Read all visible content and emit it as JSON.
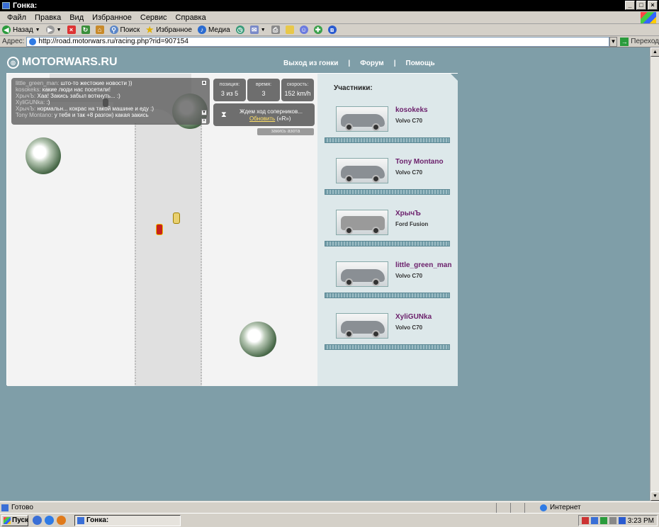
{
  "window": {
    "title": "Гонка:"
  },
  "menu": [
    "Файл",
    "Правка",
    "Вид",
    "Избранное",
    "Сервис",
    "Справка"
  ],
  "toolbar": {
    "back": "Назад",
    "search": "Поиск",
    "favorites": "Избранное",
    "media": "Медиа"
  },
  "address": {
    "label": "Адрес:",
    "url": "http://road.motorwars.ru/racing.php?rid=907154",
    "go": "Переход"
  },
  "site": {
    "logo": "MOTORWARS.RU",
    "nav": [
      "Выход из гонки",
      "Форум",
      "Помощь"
    ],
    "chat": [
      {
        "nick": "little_green_man:",
        "text": " што-то жестокие новости ))"
      },
      {
        "nick": "kosokeks:",
        "text": " какие люди нас посетили!"
      },
      {
        "nick": "ХрычЪ:",
        "text": " Хаа! Закись забыл воткнуть... :)"
      },
      {
        "nick": "XyliGUNka:",
        "text": " :)"
      },
      {
        "nick": "ХрычЪ:",
        "text": " нормальн... кокрас на такой машине и еду :)"
      },
      {
        "nick": "Tony Montano:",
        "text": " у тебя и так +8 разгон) какая закись"
      }
    ],
    "stats": {
      "position_label": "позиция:",
      "position_value": "3 из 5",
      "time_label": "время:",
      "time_value": "3",
      "speed_label": "скорость:",
      "speed_value": "152 km/h"
    },
    "wait": {
      "text": "Ждем ход соперников...",
      "refresh": "Обновить",
      "hotkey": "(«R»)"
    },
    "close_nitro": "закись азота",
    "participants_title": "Участники:",
    "players": [
      {
        "name": "kosokeks",
        "car": "Volvo C70"
      },
      {
        "name": "Tony Montano",
        "car": "Volvo C70"
      },
      {
        "name": "ХрычЪ",
        "car": "Ford Fusion"
      },
      {
        "name": "little_green_man",
        "car": "Volvo C70"
      },
      {
        "name": "XyliGUNka",
        "car": "Volvo C70"
      }
    ]
  },
  "status": {
    "text": "Готово",
    "zone": "Интернет"
  },
  "taskbar": {
    "start": "Пуск",
    "task": "Гонка:",
    "clock": "3:23 PM"
  }
}
